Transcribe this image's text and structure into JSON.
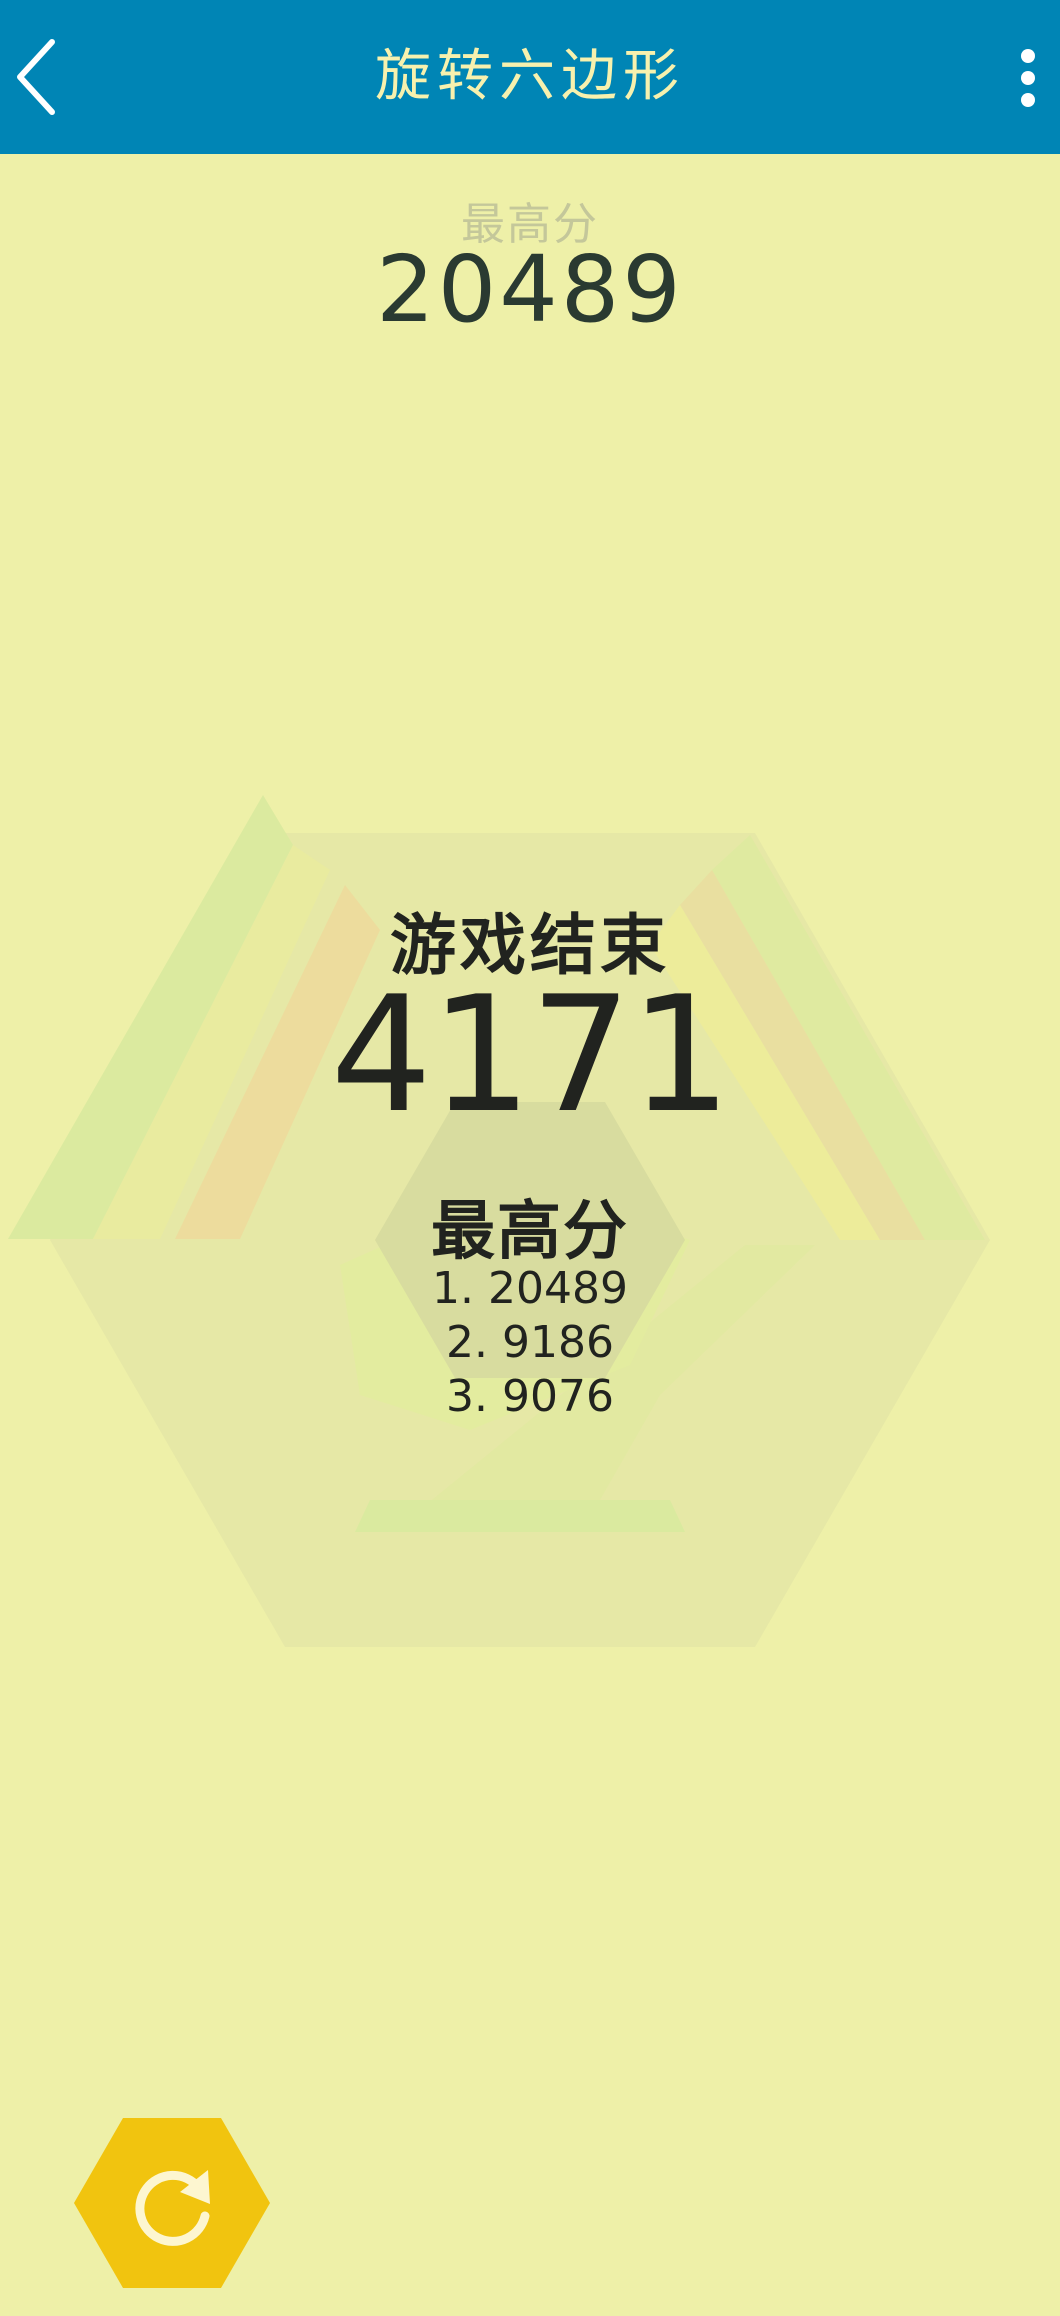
{
  "header": {
    "title": "旋转六边形",
    "back_icon": "chevron-left-icon",
    "menu_icon": "more-vertical-icon"
  },
  "best": {
    "label": "最高分",
    "value": "20489"
  },
  "game_over": {
    "title": "游戏结束",
    "score": "4171"
  },
  "high_scores": {
    "heading": "最高分",
    "entries": [
      "1. 20489",
      "2. 9186",
      "3. 9076"
    ]
  },
  "restart": {
    "icon": "restart-icon"
  },
  "colors": {
    "header_bg": "#0085b5",
    "header_text": "#f7f1ae",
    "background": "#eef0a8",
    "button": "#f1c40f"
  }
}
